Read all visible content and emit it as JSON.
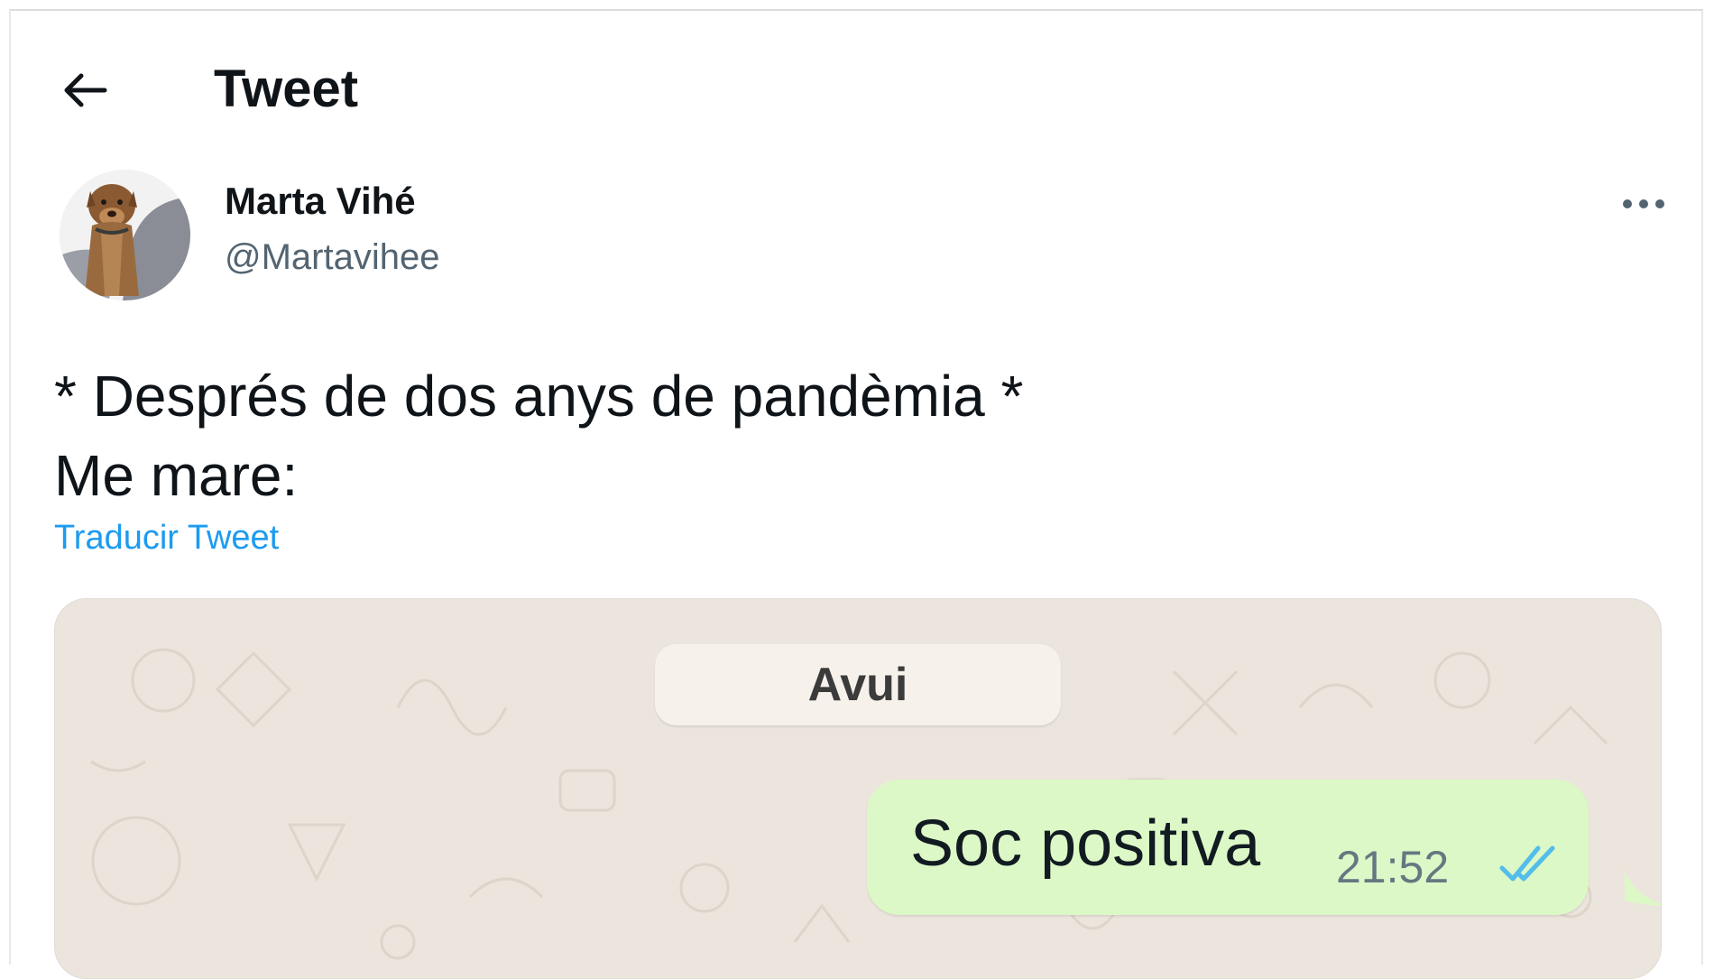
{
  "header": {
    "title": "Tweet",
    "back_icon": "arrow-left-icon"
  },
  "author": {
    "name": "Marta Vihé",
    "handle": "@Martavihee",
    "avatar_icon": "dog-avatar",
    "more_icon": "more-horizontal-icon"
  },
  "tweet": {
    "lines": [
      "* Després de dos anys de pandèmia *",
      "Me mare:"
    ],
    "translate_label": "Traducir Tweet",
    "link_color": "#1d9bf0"
  },
  "media": {
    "date_label": "Avui",
    "message": {
      "text": "Soc positiva",
      "time": "21:52",
      "status_icon": "double-check-read-icon",
      "bubble_color": "#dcf8c6"
    }
  }
}
